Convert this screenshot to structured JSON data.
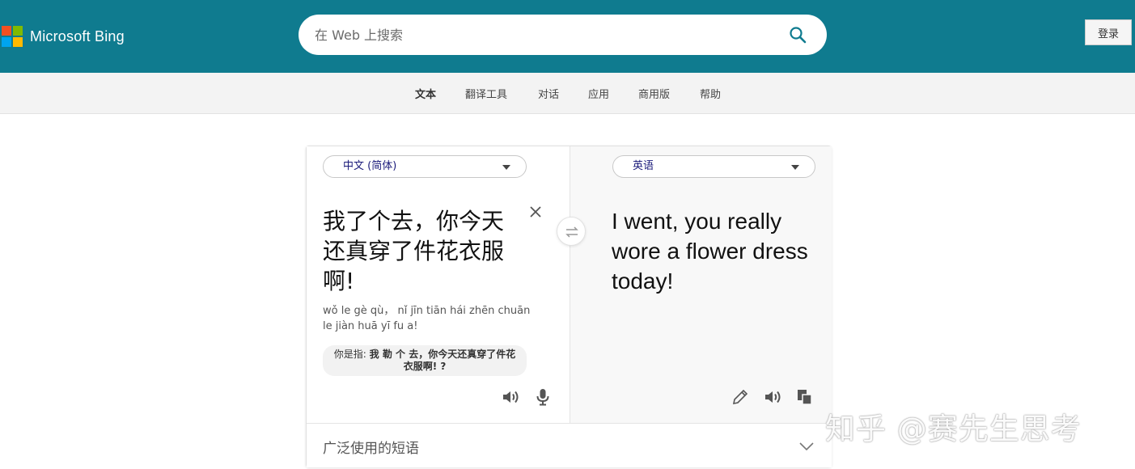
{
  "header": {
    "brand": "Microsoft Bing",
    "search_placeholder": "在 Web 上搜索",
    "login_label": "登录",
    "accent_color": "#0f7b8f"
  },
  "nav": {
    "items": [
      {
        "label": "文本",
        "active": true
      },
      {
        "label": "翻译工具"
      },
      {
        "label": "对话"
      },
      {
        "label": "应用"
      },
      {
        "label": "商用版"
      },
      {
        "label": "帮助"
      }
    ]
  },
  "translator": {
    "source_lang": "中文 (简体)",
    "target_lang": "英语",
    "source_text": "我了个去，你今天还真穿了件花衣服啊!",
    "pinyin": "wǒ le gè qù，  nǐ jīn tiān hái zhēn chuān le jiàn huā yī fu a!",
    "suggest_prefix": "你是指:",
    "suggest_text": "我 勒 个 去，你今天还真穿了件花衣服啊! ?",
    "target_text": "I went, you really wore a flower dress today!",
    "phrases_label": "广泛使用的短语"
  },
  "watermark": "知乎 @赛先生思考"
}
